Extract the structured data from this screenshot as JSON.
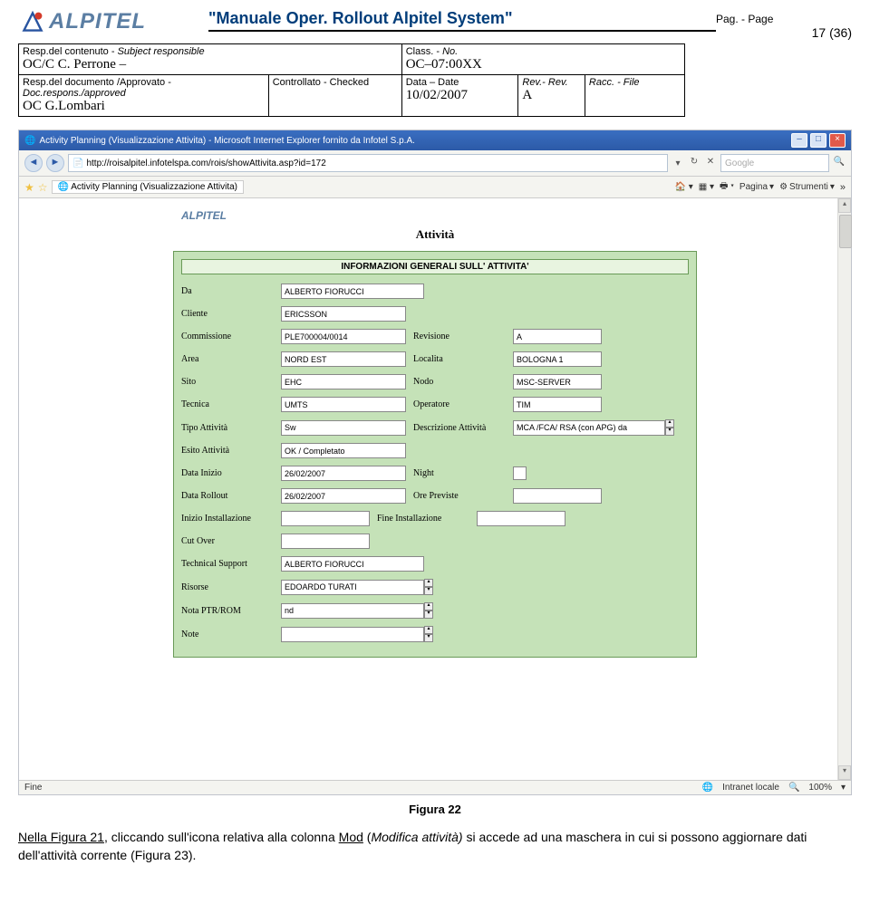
{
  "header": {
    "logo_text": "ALPITEL",
    "title_quote_open": "\"",
    "title_main": "Manuale Oper. Rollout Alpitel System",
    "title_quote_close": "\"",
    "pag_label": "Pag. - Page",
    "pag_num": "17 (36)"
  },
  "meta": {
    "row1": {
      "c1a": "Resp.del contenuto - ",
      "c1b": "Subject responsible",
      "c2a": "Class. - ",
      "c2b": "No."
    },
    "row2": {
      "c1": "OC/C C. Perrone –",
      "c2": "OC–07:00XX"
    },
    "row3": {
      "c1a": "Resp.del documento /Approvato - ",
      "c1b": "Doc.respons./approved",
      "c2": "Controllato - Checked",
      "c3": "Data – Date",
      "c4": "Rev.- Rev.",
      "c5": "Racc. - File"
    },
    "row4": {
      "c1": "OC G.Lombari",
      "c2": "",
      "c3": "10/02/2007",
      "c4": "A",
      "c5": ""
    }
  },
  "browser": {
    "window_title": "Activity Planning (Visualizzazione Attivita) - Microsoft Internet Explorer fornito da Infotel S.p.A.",
    "url": "http://roisalpitel.infotelspa.com/rois/showAttivita.asp?id=172",
    "search_placeholder": "Google",
    "tab_title": "Activity Planning (Visualizzazione Attivita)",
    "tool_pagina": "Pagina",
    "tool_strumenti": "Strumenti",
    "status_left": "Fine",
    "status_intranet": "Intranet locale",
    "status_zoom": "100%"
  },
  "form": {
    "logo": "ALPITEL",
    "page_title": "Attività",
    "box_header": "INFORMAZIONI GENERALI SULL' ATTIVITA'",
    "fields": {
      "da": {
        "label": "Da",
        "value": "ALBERTO FIORUCCI"
      },
      "cliente": {
        "label": "Cliente",
        "value": "ERICSSON"
      },
      "commissione": {
        "label": "Commissione",
        "value": "PLE700004/0014"
      },
      "revisione": {
        "label": "Revisione",
        "value": "A"
      },
      "area": {
        "label": "Area",
        "value": "NORD EST"
      },
      "localita": {
        "label": "Localita",
        "value": "BOLOGNA 1"
      },
      "sito": {
        "label": "Sito",
        "value": "EHC"
      },
      "nodo": {
        "label": "Nodo",
        "value": "MSC-SERVER"
      },
      "tecnica": {
        "label": "Tecnica",
        "value": "UMTS"
      },
      "operatore": {
        "label": "Operatore",
        "value": "TIM"
      },
      "tipo": {
        "label": "Tipo Attività",
        "value": "Sw"
      },
      "descrizione": {
        "label": "Descrizione Attività",
        "value": "MCA /FCA/ RSA (con APG) da"
      },
      "esito": {
        "label": "Esito Attività",
        "value": "OK / Completato"
      },
      "data_inizio": {
        "label": "Data Inizio",
        "value": "26/02/2007"
      },
      "night": {
        "label": "Night",
        "value": ""
      },
      "data_rollout": {
        "label": "Data Rollout",
        "value": "26/02/2007"
      },
      "ore_previste": {
        "label": "Ore Previste",
        "value": ""
      },
      "inizio_inst": {
        "label": "Inizio Installazione",
        "value": ""
      },
      "fine_inst": {
        "label": "Fine Installazione",
        "value": ""
      },
      "cut_over": {
        "label": "Cut Over",
        "value": ""
      },
      "tech_support": {
        "label": "Technical Support",
        "value": "ALBERTO FIORUCCI"
      },
      "risorse": {
        "label": "Risorse",
        "value": "EDOARDO TURATI"
      },
      "nota_ptr": {
        "label": "Nota PTR/ROM",
        "value": "nd"
      },
      "note": {
        "label": "Note",
        "value": ""
      }
    }
  },
  "caption": "Figura 22",
  "body": {
    "ul_part": "Nella Figura 21",
    "text1": ", cliccando sull'icona relativa alla colonna ",
    "ul2": "Mod",
    "text2": " (",
    "it1": "Modifica attività)",
    "text3": " si accede ad una maschera in cui si possono aggiornare  dati dell'attività corrente  (Figura 23)."
  }
}
